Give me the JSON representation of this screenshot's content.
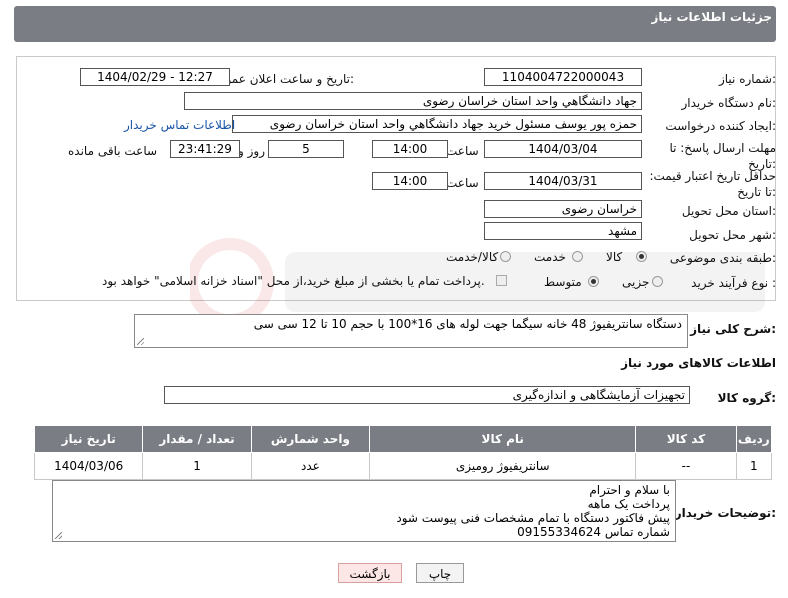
{
  "header": {
    "title": "جزئیات اطلاعات نیاز"
  },
  "form": {
    "need_number_label": "شماره نیاز:",
    "need_number": "1104004722000043",
    "announce_label": "تاریخ و ساعت اعلان عمومی:",
    "announce_value": "1404/02/29 - 12:27",
    "buyer_org_label": "نام دستگاه خریدار:",
    "buyer_org": "جهاد دانشگاهي واحد استان خراسان رضوی",
    "requester_label": "ایجاد کننده درخواست:",
    "requester": "حمزه  پور یوسف مسئول خرید جهاد دانشگاهي واحد استان خراسان رضوی",
    "contact_link": "اطلاعات تماس خریدار",
    "deadline_label": "مهلت ارسال پاسخ: تا تاریخ:",
    "deadline_date": "1404/03/04",
    "time_label": "ساعت",
    "deadline_time": "14:00",
    "days_value": "5",
    "days_label": "روز و",
    "remaining_time": "23:41:29",
    "remaining_label": "ساعت باقی مانده",
    "price_validity_label": "حداقل تاریخ اعتبار قیمت: تا تاریخ:",
    "price_validity_date": "1404/03/31",
    "price_validity_time": "14:00",
    "delivery_province_label": "استان محل تحویل:",
    "delivery_province": "خراسان رضوی",
    "delivery_city_label": "شهر محل تحویل:",
    "delivery_city": "مشهد",
    "category_label": "طبقه بندی موضوعی:",
    "category_options": [
      "کالا",
      "خدمت",
      "کالا/خدمت"
    ],
    "category_selected": "کالا",
    "purchase_type_label": "نوع فرآیند خرید :",
    "purchase_options": [
      "جزیی",
      "متوسط"
    ],
    "purchase_selected": "متوسط",
    "payment_note": "پرداخت تمام یا بخشی از مبلغ خرید،از محل \"اسناد خزانه اسلامی\" خواهد بود."
  },
  "description": {
    "label": "شرح کلی نیاز:",
    "text": "دستگاه سانتریفیوژ 48 خانه سیگما جهت لوله های 16*100 با حجم 10 تا 12 سی سی"
  },
  "items_section": {
    "title": "اطلاعات کالاهای مورد نیاز",
    "group_label": "گروه کالا:",
    "group_value": "تجهیزات آزمایشگاهی و اندازه‌گیری",
    "columns": [
      "ردیف",
      "کد کالا",
      "نام کالا",
      "واحد شمارش",
      "تعداد / مقدار",
      "تاریخ نیاز"
    ],
    "rows": [
      {
        "row": "1",
        "code": "--",
        "name": "سانتریفیوژ رومیزی",
        "unit": "عدد",
        "qty": "1",
        "date": "1404/03/06"
      }
    ]
  },
  "buyer_notes": {
    "label": "توضیحات خریدار:",
    "lines": [
      "با سلام و احترام",
      "پرداخت یک ماهه",
      "پیش فاکتور دستگاه با تمام مشخصات فنی پیوست شود",
      "شماره تماس 09155334624"
    ]
  },
  "buttons": {
    "print": "چاپ",
    "back": "بازگشت"
  },
  "colors": {
    "header_bg": "#7a7d83",
    "link": "#1a55a8",
    "back_button_bg": "#fde6e6"
  }
}
